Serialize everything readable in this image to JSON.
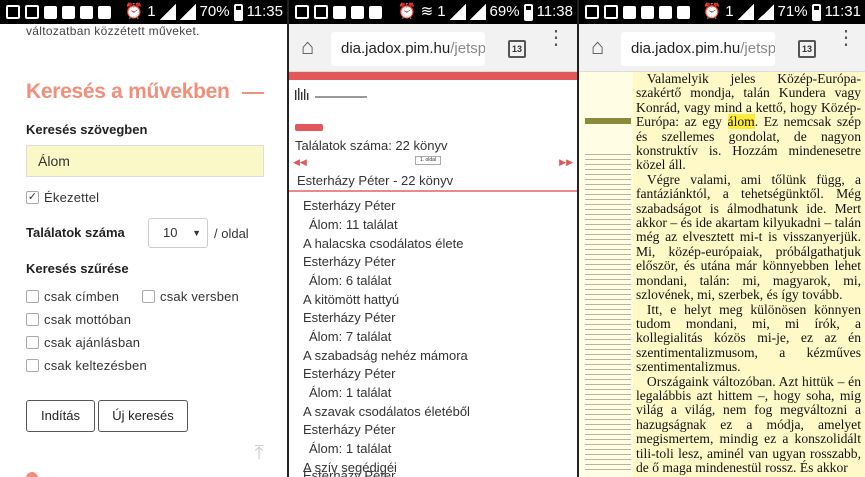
{
  "panel1": {
    "status": {
      "time": "11:35",
      "battery": "70%",
      "notif": "7.0",
      "sim": "1"
    },
    "intro_text": "változatban közzétett műveket.",
    "heading": "Keresés a művekben",
    "search_label": "Keresés szövegben",
    "search_value": "Álom",
    "accent_checkbox": "Ékezettel",
    "results_label": "Találatok száma",
    "results_value": "10",
    "per_page": "/ oldal",
    "filter_label": "Keresés szűrése",
    "filters": [
      "csak címben",
      "csak versben",
      "csak mottóban",
      "csak ajánlásban",
      "csak keltezésben"
    ],
    "start_button": "Indítás",
    "new_search_button": "Új keresés",
    "accent_color": "#f08f7a"
  },
  "panel2": {
    "status": {
      "time": "11:38",
      "battery": "69%",
      "sim": "1"
    },
    "url_main": "dia.jadox.pim.hu",
    "url_path": "/jetsp",
    "tab_count": "13",
    "hit_count": "Találatok száma: 22 könyv",
    "group_title": "Esterházy Péter - 22 könyv",
    "results": [
      {
        "author": "Esterházy Péter",
        "hits": "Álom: 11 találat",
        "title": "A halacska csodálatos élete"
      },
      {
        "author": "Esterházy Péter",
        "hits": "Álom: 6 találat",
        "title": "A kitömött hattyú"
      },
      {
        "author": "Esterházy Péter",
        "hits": "Álom: 7 találat",
        "title": "A szabadság nehéz mámora"
      },
      {
        "author": "Esterházy Péter",
        "hits": "Álom: 1 találat",
        "title": "A szavak csodálatos életéből"
      },
      {
        "author": "Esterházy Péter",
        "hits": "Álom: 1 találat",
        "title": "A szív segédigéi"
      },
      {
        "author": "Esterházy Péter",
        "hits": "",
        "title": ""
      }
    ]
  },
  "panel3": {
    "status": {
      "time": "11:31",
      "battery": "71%",
      "sim": "1"
    },
    "url_main": "dia.jadox.pim.hu",
    "url_path": "/jetsp",
    "tab_count": "13",
    "para1_lead": "Valamelyik jeles Közép-Európa-szakértő mondja, talán Kundera vagy Konrád, vagy mind a kettő, hogy Közép-Európa: az egy ",
    "para1_hl": "álom",
    "para1_tail": ". Ez nemcsak szép és szellemes gondolat, de nagyon konstruktív is. Hozzám mindenesetre közel áll.",
    "para2": "Végre valami, ami tőlünk függ, a fantáziánktól, a tehetségünktől. Még szabadságot is álmodhatunk ide. Mert akkor – és ide akartam kilyukadni – talán még az elvesztett mi-t is visszanyerjük. Mi, közép-európaiak, próbálgathatjuk először, és utána már könnyebben lehet mondani, talán: mi, magyarok, mi, szlovének, mi, szerbek, és így tovább.",
    "para3": "Itt, e helyt meg különösen könnyen tudom mondani, mi, mi írók, a kollegialitás kózös mi-je, ez az én szentimentalizmusom, a kézműves szentimentalizmus.",
    "para4": "Országaink változóban. Azt hittük – én legalábbis azt hittem –, hogy soha, mig világ a világ, nem fog megváltozni a hazugságnak ez a módja, amelyet megismertem, mindig ez a konszolidált tili-toli lesz, aminél van ugyan rosszabb, de ő maga mindenestül rossz. És akkor",
    "highlight_color": "#ffeb3b"
  }
}
